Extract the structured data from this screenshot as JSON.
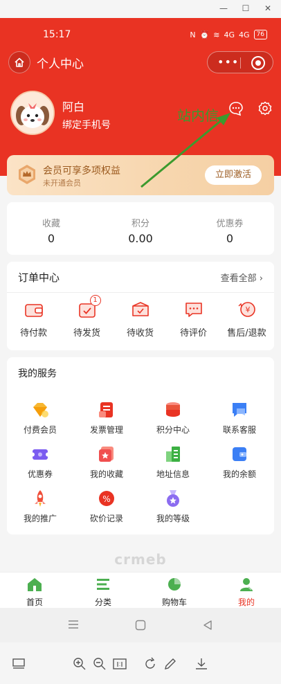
{
  "status": {
    "time": "15:17",
    "battery": "76",
    "signal_a": "4G",
    "signal_b": "4G"
  },
  "nav": {
    "title": "个人中心"
  },
  "profile": {
    "name": "阿白",
    "bind_phone": "绑定手机号"
  },
  "annotation": {
    "text": "站内信"
  },
  "vip": {
    "title": "会员可享多项权益",
    "subtitle": "未开通会员",
    "button": "立即激活"
  },
  "stats": [
    {
      "label": "收藏",
      "value": "0"
    },
    {
      "label": "积分",
      "value": "0.00"
    },
    {
      "label": "优惠券",
      "value": "0"
    }
  ],
  "orders": {
    "title": "订单中心",
    "see_all": "查看全部",
    "items": [
      {
        "label": "待付款",
        "icon": "wallet-icon",
        "badge": ""
      },
      {
        "label": "待发货",
        "icon": "calendar-check-icon",
        "badge": "1"
      },
      {
        "label": "待收货",
        "icon": "box-icon",
        "badge": ""
      },
      {
        "label": "待评价",
        "icon": "comment-icon",
        "badge": ""
      },
      {
        "label": "售后/退款",
        "icon": "refund-icon",
        "badge": ""
      }
    ]
  },
  "services": {
    "title": "我的服务",
    "items": [
      {
        "label": "付费会员",
        "icon": "diamond-icon",
        "color": "#f7b731"
      },
      {
        "label": "发票管理",
        "icon": "invoice-icon",
        "color": "#e93323"
      },
      {
        "label": "积分中心",
        "icon": "coins-icon",
        "color": "#e9533b"
      },
      {
        "label": "联系客服",
        "icon": "chat-icon",
        "color": "#3b7ff5"
      },
      {
        "label": "优惠券",
        "icon": "ticket-icon",
        "color": "#7b5cf0"
      },
      {
        "label": "我的收藏",
        "icon": "star-box-icon",
        "color": "#f04f4f"
      },
      {
        "label": "地址信息",
        "icon": "building-icon",
        "color": "#3cb043"
      },
      {
        "label": "我的余额",
        "icon": "wallet-card-icon",
        "color": "#3b7ff5"
      },
      {
        "label": "我的推广",
        "icon": "rocket-icon",
        "color": "#f04f3a"
      },
      {
        "label": "砍价记录",
        "icon": "discount-icon",
        "color": "#e93323"
      },
      {
        "label": "我的等级",
        "icon": "medal-icon",
        "color": "#8b6cf0"
      }
    ]
  },
  "watermark": "crmeb",
  "tabs": [
    {
      "label": "首页",
      "icon": "home-icon"
    },
    {
      "label": "分类",
      "icon": "list-icon"
    },
    {
      "label": "购物车",
      "icon": "pie-cart-icon"
    },
    {
      "label": "我的",
      "icon": "user-icon",
      "active": true
    }
  ],
  "colors": {
    "brand": "#e93323",
    "annotation": "#3c9a2e"
  }
}
